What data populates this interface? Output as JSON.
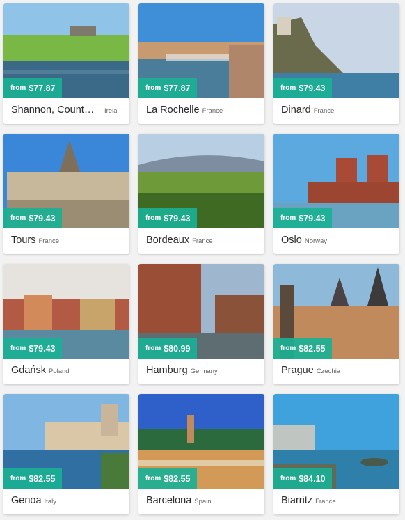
{
  "destinations": [
    {
      "city": "Shannon, County ...",
      "country": "Irela",
      "from": "from",
      "price": "$77.87",
      "colors": [
        "#8fc3e8",
        "#79b844",
        "#3a6a88"
      ]
    },
    {
      "city": "La Rochelle",
      "country": "France",
      "from": "from",
      "price": "$77.87",
      "colors": [
        "#3f8ed8",
        "#c89a70",
        "#4a7d9a"
      ]
    },
    {
      "city": "Dinard",
      "country": "France",
      "from": "from",
      "price": "$79.43",
      "colors": [
        "#c9d6e6",
        "#6a6a4c",
        "#3f7fa6"
      ]
    },
    {
      "city": "Tours",
      "country": "France",
      "from": "from",
      "price": "$79.43",
      "colors": [
        "#3a86d8",
        "#c7b89c",
        "#7e6f5a"
      ]
    },
    {
      "city": "Bordeaux",
      "country": "France",
      "from": "from",
      "price": "$79.43",
      "colors": [
        "#b8cfe3",
        "#6f9a3a",
        "#3f6a24"
      ]
    },
    {
      "city": "Oslo",
      "country": "Norway",
      "from": "from",
      "price": "$79.43",
      "colors": [
        "#5ca9e0",
        "#a84a35",
        "#6aa3c2"
      ]
    },
    {
      "city": "Gdańsk",
      "country": "Poland",
      "from": "from",
      "price": "$79.43",
      "colors": [
        "#e6e3de",
        "#b25a44",
        "#5a8aa0"
      ]
    },
    {
      "city": "Hamburg",
      "country": "Germany",
      "from": "from",
      "price": "$80.99",
      "colors": [
        "#9fb6cf",
        "#9a4e36",
        "#5d6d72"
      ]
    },
    {
      "city": "Prague",
      "country": "Czechia",
      "from": "from",
      "price": "$82.55",
      "colors": [
        "#8eb9d9",
        "#c08a5c",
        "#5b4a3c"
      ]
    },
    {
      "city": "Genoa",
      "country": "Italy",
      "from": "from",
      "price": "$82.55",
      "colors": [
        "#7fb6e2",
        "#d9c7a8",
        "#2f6fa2"
      ]
    },
    {
      "city": "Barcelona",
      "country": "Spain",
      "from": "from",
      "price": "$82.55",
      "colors": [
        "#2f5fc8",
        "#d29a56",
        "#2b6a3c"
      ]
    },
    {
      "city": "Biarritz",
      "country": "France",
      "from": "from",
      "price": "$84.10",
      "colors": [
        "#3fa2dc",
        "#bfc6c2",
        "#2e7fa9"
      ]
    }
  ],
  "accent_color": "#1ab094"
}
